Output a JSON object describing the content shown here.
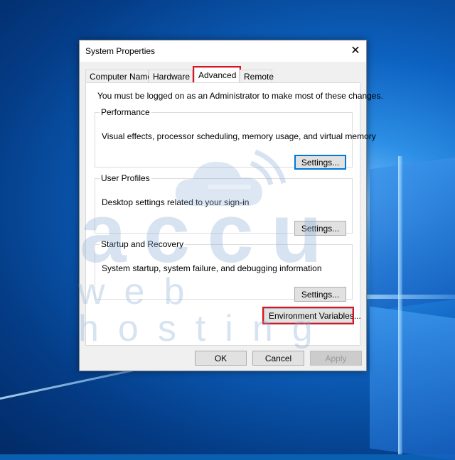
{
  "dialog": {
    "title": "System Properties",
    "close_glyph": "✕"
  },
  "tabs": [
    {
      "label": "Computer Name",
      "active": false
    },
    {
      "label": "Hardware",
      "active": false
    },
    {
      "label": "Advanced",
      "active": true
    },
    {
      "label": "Remote",
      "active": false
    }
  ],
  "advanced": {
    "admin_note": "You must be logged on as an Administrator to make most of these changes.",
    "performance": {
      "title": "Performance",
      "description": "Visual effects, processor scheduling, memory usage, and virtual memory",
      "button": "Settings..."
    },
    "user_profiles": {
      "title": "User Profiles",
      "description": "Desktop settings related to your sign-in",
      "button": "Settings..."
    },
    "startup_recovery": {
      "title": "Startup and Recovery",
      "description": "System startup, system failure, and debugging information",
      "button": "Settings..."
    },
    "env_button": "Environment Variables..."
  },
  "footer": {
    "ok": "OK",
    "cancel": "Cancel",
    "apply": "Apply"
  },
  "watermark": {
    "brand": "accu",
    "tagline": "web hosting"
  },
  "colors": {
    "highlight": "#e01020",
    "default_button_border": "#0078d7",
    "dialog_bg": "#f0f0f0"
  }
}
